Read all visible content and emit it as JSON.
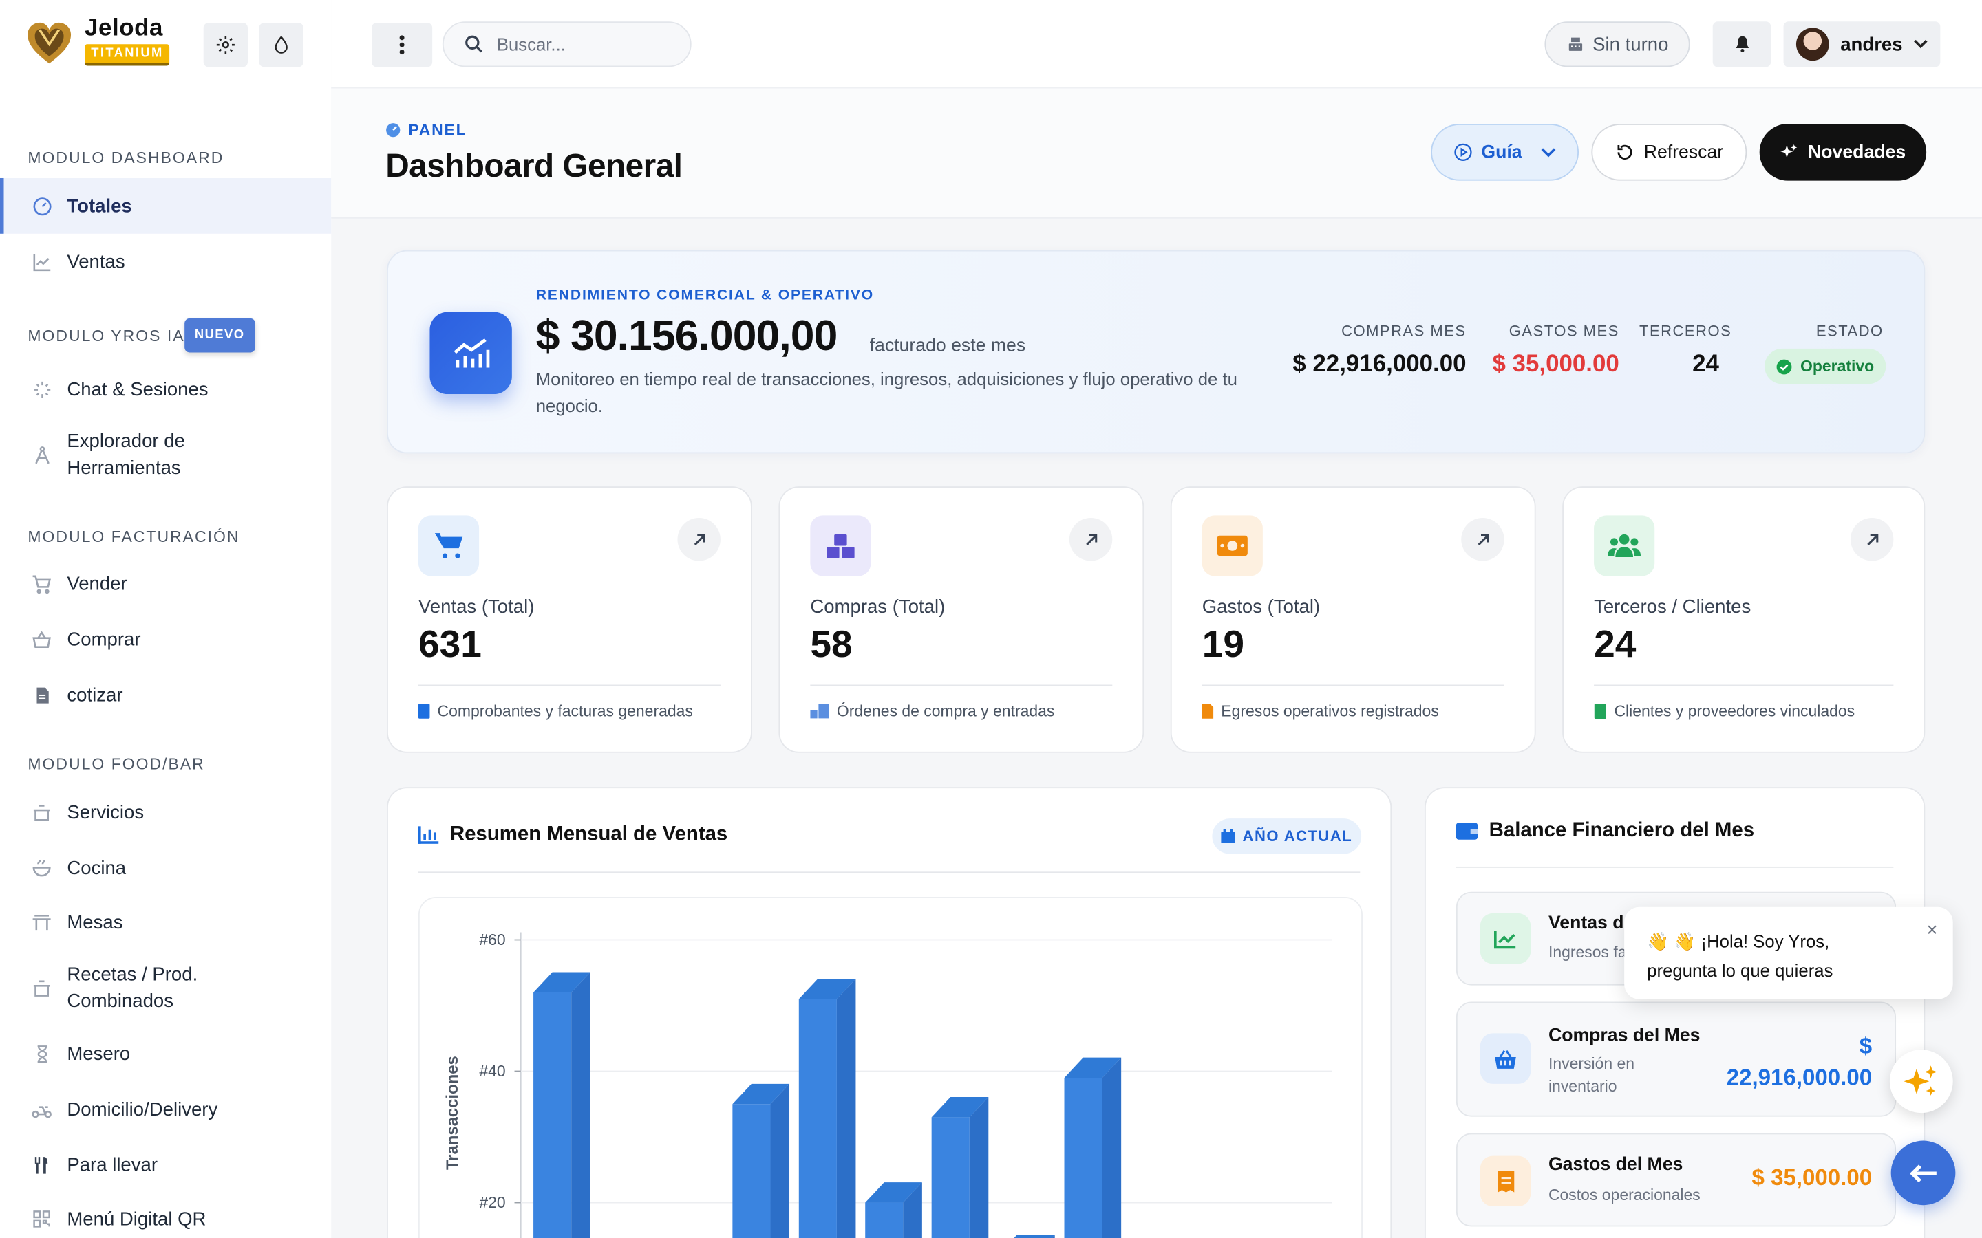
{
  "brand": {
    "name": "Jeloda",
    "tier": "TITANIUM"
  },
  "icons": {
    "settings": "gear-icon",
    "theme": "droplet-icon",
    "menu": "dots-vertical-icon",
    "search": "search-icon",
    "notifications": "bell-icon"
  },
  "header": {
    "search_placeholder": "Buscar...",
    "shift_label": "Sin turno",
    "user_name": "andres"
  },
  "sidebar": {
    "sections": [
      {
        "title": "MODULO DASHBOARD",
        "items": [
          "Totales",
          "Ventas"
        ]
      },
      {
        "title": "MODULO YROS IA",
        "badge": "NUEVO",
        "items": [
          "Chat & Sesiones",
          "Explorador de Herramientas"
        ]
      },
      {
        "title": "MODULO FACTURACIÓN",
        "items": [
          "Vender",
          "Comprar",
          "cotizar"
        ]
      },
      {
        "title": "MODULO FOOD/BAR",
        "items": [
          "Servicios",
          "Cocina",
          "Mesas",
          "Recetas / Prod. Combinados",
          "Mesero",
          "Domicilio/Delivery",
          "Para llevar",
          "Menú Digital QR"
        ]
      }
    ],
    "active_item": "Totales"
  },
  "page": {
    "crumb": "PANEL",
    "title": "Dashboard General",
    "buttons": {
      "guide": "Guía",
      "refresh": "Refrescar",
      "news": "Novedades"
    }
  },
  "hero": {
    "kicker": "RENDIMIENTO COMERCIAL & OPERATIVO",
    "amount": "$ 30.156.000,00",
    "amount_suffix": "facturado este mes",
    "description": "Monitoreo en tiempo real de transacciones, ingresos, adquisiciones y flujo operativo de tu negocio.",
    "stats": [
      {
        "label": "COMPRAS MES",
        "value": "$ 22,916,000.00"
      },
      {
        "label": "GASTOS MES",
        "value": "$ 35,000.00"
      },
      {
        "label": "TERCEROS",
        "value": "24"
      },
      {
        "label": "ESTADO",
        "value": "Operativo"
      }
    ],
    "colors": {
      "expense": "#e23b3b",
      "status": "#15803d"
    }
  },
  "stat_cards": [
    {
      "label": "Ventas (Total)",
      "value": "631",
      "footer": "Comprobantes y facturas generadas",
      "icon": "cart-icon",
      "color": "#1d6fe0"
    },
    {
      "label": "Compras (Total)",
      "value": "58",
      "footer": "Órdenes de compra y entradas",
      "icon": "boxes-icon",
      "color": "#5b4fcf"
    },
    {
      "label": "Gastos (Total)",
      "value": "19",
      "footer": "Egresos operativos registrados",
      "icon": "money-icon",
      "color": "#f08a0c"
    },
    {
      "label": "Terceros / Clientes",
      "value": "24",
      "footer": "Clientes y proveedores vinculados",
      "icon": "users-icon",
      "color": "#22a55a"
    }
  ],
  "chart": {
    "title": "Resumen Mensual de Ventas",
    "badge": "AÑO ACTUAL"
  },
  "chart_data": {
    "type": "bar",
    "ylabel": "Transacciones",
    "yticks": [
      "#60",
      "#40",
      "#20"
    ],
    "ylim": [
      0,
      60
    ],
    "values": [
      52,
      null,
      null,
      35,
      51,
      20,
      33,
      12,
      39
    ],
    "color": "#3a84e0"
  },
  "balance": {
    "title": "Balance Financiero del Mes",
    "items": [
      {
        "name": "Ventas d",
        "sub": "Ingresos fa",
        "value": "",
        "color": "#22a55a"
      },
      {
        "name": "Compras del Mes",
        "sub": "Inversión en inventario",
        "value": "$ 22,916,000.00",
        "color": "#1d6fe0"
      },
      {
        "name": "Gastos del Mes",
        "sub": "Costos operacionales",
        "value": "$ 35,000.00",
        "color": "#f08a0c"
      }
    ]
  },
  "chat": {
    "greeting_line1": "👋  👋 ¡Hola! Soy Yros,",
    "greeting_line2": "pregunta lo que quieras",
    "close": "×"
  }
}
